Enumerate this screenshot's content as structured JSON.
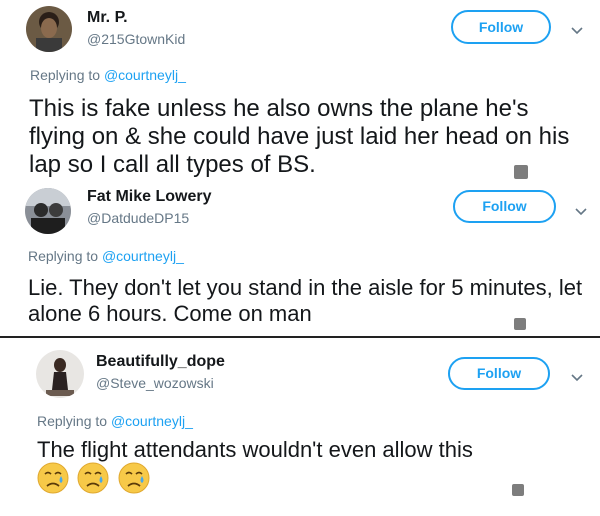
{
  "tweets": [
    {
      "name": "Mr. P.",
      "handle": "@215GtownKid",
      "follow_label": "Follow",
      "replying_prefix": "Replying to ",
      "replying_to": "@courtneylj_",
      "text": "This is fake unless he also owns the plane he's flying on & she could have just laid her head on his lap so I call all types of BS."
    },
    {
      "name": "Fat Mike Lowery",
      "handle": "@DatdudeDP15",
      "follow_label": "Follow",
      "replying_prefix": "Replying to ",
      "replying_to": "@courtneylj_",
      "text": "Lie. They don't let you stand in the aisle for 5 minutes, let alone 6 hours. Come on man"
    },
    {
      "name": "Beautifully_dope",
      "handle": "@Steve_wozowski",
      "follow_label": "Follow",
      "replying_prefix": "Replying to ",
      "replying_to": "@courtneylj_",
      "text": "The flight attendants wouldn't even allow this",
      "emojis": [
        "sad-relieved-face-icon",
        "sad-relieved-face-icon",
        "sad-relieved-face-icon"
      ]
    }
  ],
  "colors": {
    "accent": "#1da1f2",
    "secondary_text": "#657786",
    "primary_text": "#14171a"
  }
}
